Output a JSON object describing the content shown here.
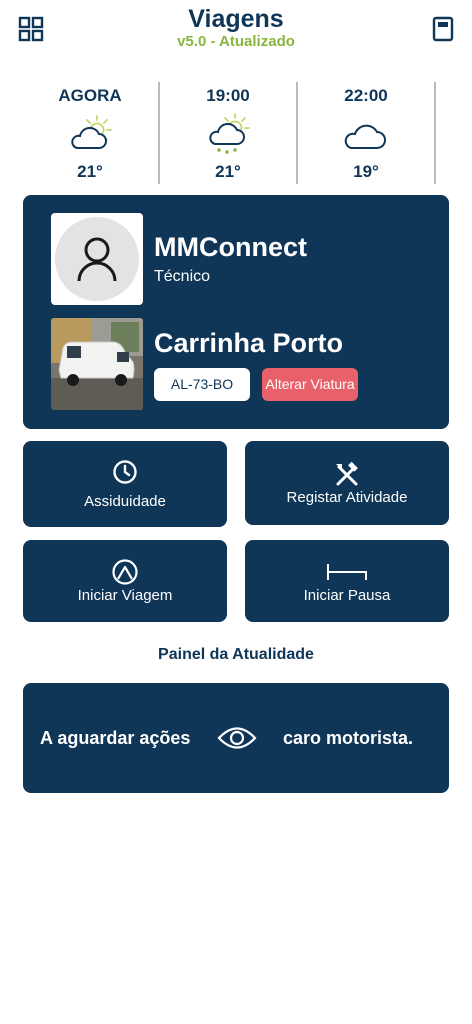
{
  "header": {
    "title": "Viagens",
    "subtitle": "v5.0 - Atualizado",
    "menu_icon": "grid-icon",
    "book_icon": "book-icon"
  },
  "weather": [
    {
      "time": "AGORA",
      "icon": "cloud-sun-icon",
      "temp": "21°"
    },
    {
      "time": "19:00",
      "icon": "cloud-sun-rain-icon",
      "temp": "21°"
    },
    {
      "time": "22:00",
      "icon": "cloud-icon",
      "temp": "19°"
    }
  ],
  "profile": {
    "name": "MMConnect",
    "role": "Técnico",
    "vehicle_name": "Carrinha Porto",
    "plate": "AL-73-BO",
    "change_vehicle_label": "Alterar Viatura"
  },
  "actions": {
    "attendance": "Assiduidade",
    "register_activity": "Registar Atividade",
    "start_trip": "Iniciar Viagem",
    "start_pause": "Iniciar Pausa"
  },
  "panel": {
    "title": "Painel da Atualidade",
    "message_left": "A aguardar ações",
    "message_right": "caro motorista."
  },
  "colors": {
    "primary": "#0f3557",
    "accent_green": "#8ab63f",
    "danger": "#e8606a",
    "sun": "#c4d86a",
    "rain": "#8ab63f"
  }
}
